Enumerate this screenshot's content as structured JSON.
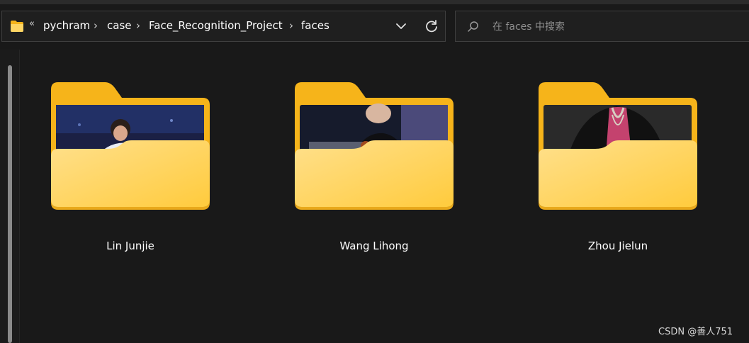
{
  "address_bar": {
    "overflow_chevron": "«",
    "breadcrumbs": [
      "pychram",
      "case",
      "Face_Recognition_Project",
      "faces"
    ],
    "separator": "›",
    "dropdown_icon": "chevron-down-icon",
    "refresh_icon": "refresh-icon",
    "folder_icon": "folder-icon"
  },
  "search": {
    "placeholder": "在 faces 中搜索",
    "value": "",
    "icon": "search-icon"
  },
  "folders": [
    {
      "name": "Lin Junjie"
    },
    {
      "name": "Wang Lihong"
    },
    {
      "name": "Zhou Jielun"
    }
  ],
  "watermark": "CSDN @善人751",
  "colors": {
    "background": "#191919",
    "folder_back": "#f6b41a",
    "folder_front": "#ffd664"
  }
}
